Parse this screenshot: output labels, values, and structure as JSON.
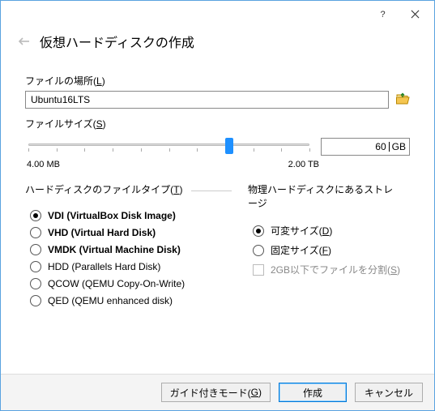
{
  "titlebar": {
    "help": "?",
    "close": "×"
  },
  "header": {
    "title": "仮想ハードディスクの作成"
  },
  "location": {
    "label": "ファイルの場所(",
    "mnemonic": "L",
    "label_close": ")",
    "value": "Ubuntu16LTS"
  },
  "size": {
    "label": "ファイルサイズ(",
    "mnemonic": "S",
    "label_close": ")",
    "min": "4.00 MB",
    "max": "2.00 TB",
    "value_num": "60",
    "value_unit": "GB"
  },
  "filetype": {
    "label": "ハードディスクのファイルタイプ(",
    "mnemonic": "T",
    "label_close": ")",
    "opts": [
      {
        "text": "VDI (VirtualBox Disk Image)",
        "bold": true,
        "selected": true
      },
      {
        "text": "VHD (Virtual Hard Disk)",
        "bold": true,
        "selected": false
      },
      {
        "text": "VMDK (Virtual Machine Disk)",
        "bold": true,
        "selected": false
      },
      {
        "text": "HDD (Parallels Hard Disk)",
        "bold": false,
        "selected": false
      },
      {
        "text": "QCOW (QEMU Copy-On-Write)",
        "bold": false,
        "selected": false
      },
      {
        "text": "QED (QEMU enhanced disk)",
        "bold": false,
        "selected": false
      }
    ]
  },
  "storage": {
    "label": "物理ハードディスクにあるストレージ",
    "opts": [
      {
        "text": "可変サイズ(",
        "mnemonic": "D",
        "close": ")",
        "selected": true
      },
      {
        "text": "固定サイズ(",
        "mnemonic": "F",
        "close": ")",
        "selected": false
      }
    ],
    "split": {
      "text": "2GB以下でファイルを分割(",
      "mnemonic": "S",
      "close": ")"
    }
  },
  "footer": {
    "guided": {
      "text": "ガイド付きモード(",
      "mnemonic": "G",
      "close": ")"
    },
    "create": "作成",
    "cancel": "キャンセル"
  }
}
